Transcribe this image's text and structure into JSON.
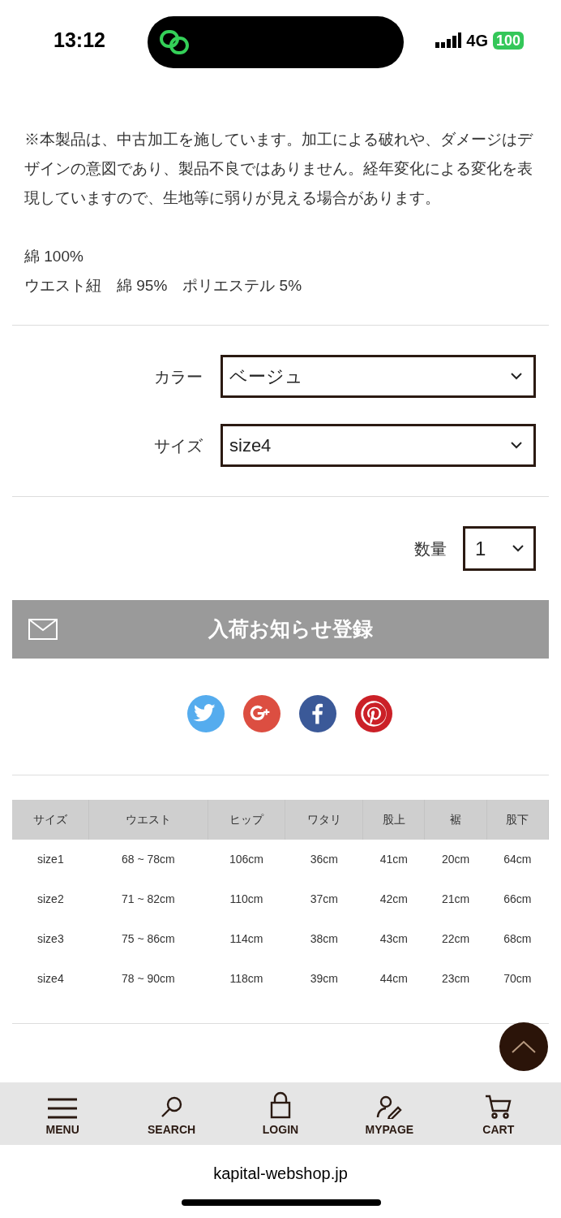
{
  "status_bar": {
    "time": "13:12",
    "network": "4G",
    "battery": "100"
  },
  "description": {
    "paragraph": "※本製品は、中古加工を施しています。加工による破れや、ダメージはデザインの意図であり、製品不良ではありません。経年変化による変化を表現していますので、生地等に弱りが見える場合があります。",
    "materials": [
      "綿 100%",
      "ウエスト紐　綿 95%　ポリエステル 5%"
    ]
  },
  "options": [
    {
      "label": "カラー",
      "value": "ベージュ"
    },
    {
      "label": "サイズ",
      "value": "size4"
    }
  ],
  "quantity": {
    "label": "数量",
    "value": "1"
  },
  "notify_button": "入荷お知らせ登録",
  "share": [
    {
      "kind": "twitter",
      "color": "#55acee"
    },
    {
      "kind": "google",
      "color": "#dc4e41"
    },
    {
      "kind": "facebook",
      "color": "#3b5998"
    },
    {
      "kind": "pinterest",
      "color": "#cb2027"
    }
  ],
  "size_table": {
    "columns": [
      "サイズ",
      "ウエスト",
      "ヒップ",
      "ワタリ",
      "股上",
      "裾",
      "股下"
    ],
    "rows": [
      [
        "size1",
        "68 ~ 78cm",
        "106cm",
        "36cm",
        "41cm",
        "20cm",
        "64cm"
      ],
      [
        "size2",
        "71 ~ 82cm",
        "110cm",
        "37cm",
        "42cm",
        "21cm",
        "66cm"
      ],
      [
        "size3",
        "75 ~ 86cm",
        "114cm",
        "38cm",
        "43cm",
        "22cm",
        "68cm"
      ],
      [
        "size4",
        "78 ~ 90cm",
        "118cm",
        "39cm",
        "44cm",
        "23cm",
        "70cm"
      ]
    ]
  },
  "bottom_nav": [
    {
      "kind": "menu",
      "label": "MENU"
    },
    {
      "kind": "search",
      "label": "SEARCH"
    },
    {
      "kind": "login",
      "label": "LOGIN"
    },
    {
      "kind": "mypage",
      "label": "MYPAGE"
    },
    {
      "kind": "cart",
      "label": "CART"
    }
  ],
  "url": "kapital-webshop.jp"
}
